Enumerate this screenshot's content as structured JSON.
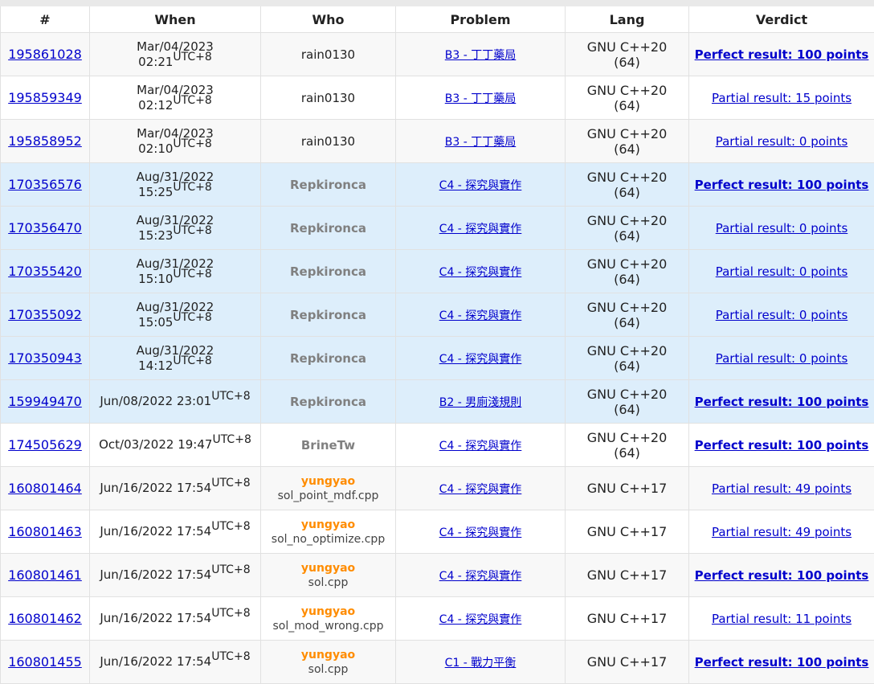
{
  "columns": {
    "id": "#",
    "when": "When",
    "who": "Who",
    "problem": "Problem",
    "lang": "Lang",
    "verdict": "Verdict"
  },
  "colors": {
    "perfect": "#00a900",
    "partial": "#0000cc",
    "gray_handle": "#808080",
    "orange_handle": "#ff8c00",
    "row_highlight": "#ddeefb"
  },
  "rows": [
    {
      "id": "195861028",
      "date": "Mar/04/2023",
      "time": "02:21",
      "tz": "UTC+8",
      "who": "rain0130",
      "file": "",
      "problem": "B3 - 丁丁藥局",
      "lang1": "GNU C++20",
      "lang2": "(64)",
      "verdict": "Perfect result: 100 points",
      "bg": "gray",
      "whoStyle": "plain",
      "vStyle": "perfect"
    },
    {
      "id": "195859349",
      "date": "Mar/04/2023",
      "time": "02:12",
      "tz": "UTC+8",
      "who": "rain0130",
      "file": "",
      "problem": "B3 - 丁丁藥局",
      "lang1": "GNU C++20",
      "lang2": "(64)",
      "verdict": "Partial result: 15 points",
      "bg": "white",
      "whoStyle": "plain",
      "vStyle": "partial"
    },
    {
      "id": "195858952",
      "date": "Mar/04/2023",
      "time": "02:10",
      "tz": "UTC+8",
      "who": "rain0130",
      "file": "",
      "problem": "B3 - 丁丁藥局",
      "lang1": "GNU C++20",
      "lang2": "(64)",
      "verdict": "Partial result: 0 points",
      "bg": "gray",
      "whoStyle": "plain",
      "vStyle": "partial"
    },
    {
      "id": "170356576",
      "date": "Aug/31/2022",
      "time": "15:25",
      "tz": "UTC+8",
      "who": "Repkironca",
      "file": "",
      "problem": "C4 - 探究與實作",
      "lang1": "GNU C++20",
      "lang2": "(64)",
      "verdict": "Perfect result: 100 points",
      "bg": "blue",
      "whoStyle": "gray",
      "vStyle": "perfect"
    },
    {
      "id": "170356470",
      "date": "Aug/31/2022",
      "time": "15:23",
      "tz": "UTC+8",
      "who": "Repkironca",
      "file": "",
      "problem": "C4 - 探究與實作",
      "lang1": "GNU C++20",
      "lang2": "(64)",
      "verdict": "Partial result: 0 points",
      "bg": "blue",
      "whoStyle": "gray",
      "vStyle": "partial"
    },
    {
      "id": "170355420",
      "date": "Aug/31/2022",
      "time": "15:10",
      "tz": "UTC+8",
      "who": "Repkironca",
      "file": "",
      "problem": "C4 - 探究與實作",
      "lang1": "GNU C++20",
      "lang2": "(64)",
      "verdict": "Partial result: 0 points",
      "bg": "blue",
      "whoStyle": "gray",
      "vStyle": "partial"
    },
    {
      "id": "170355092",
      "date": "Aug/31/2022",
      "time": "15:05",
      "tz": "UTC+8",
      "who": "Repkironca",
      "file": "",
      "problem": "C4 - 探究與實作",
      "lang1": "GNU C++20",
      "lang2": "(64)",
      "verdict": "Partial result: 0 points",
      "bg": "blue",
      "whoStyle": "gray",
      "vStyle": "partial"
    },
    {
      "id": "170350943",
      "date": "Aug/31/2022",
      "time": "14:12",
      "tz": "UTC+8",
      "who": "Repkironca",
      "file": "",
      "problem": "C4 - 探究與實作",
      "lang1": "GNU C++20",
      "lang2": "(64)",
      "verdict": "Partial result: 0 points",
      "bg": "blue",
      "whoStyle": "gray",
      "vStyle": "partial"
    },
    {
      "id": "159949470",
      "date": "Jun/08/2022",
      "time": "23:01",
      "tz": "UTC+8",
      "who": "Repkironca",
      "file": "",
      "problem": "B2 - 男廁淺規則",
      "lang1": "GNU C++20",
      "lang2": "(64)",
      "verdict": "Perfect result: 100 points",
      "bg": "blue",
      "whoStyle": "gray",
      "vStyle": "perfect",
      "oneLine": true
    },
    {
      "id": "174505629",
      "date": "Oct/03/2022",
      "time": "19:47",
      "tz": "UTC+8",
      "who": "BrineTw",
      "file": "",
      "problem": "C4 - 探究與實作",
      "lang1": "GNU C++20",
      "lang2": "(64)",
      "verdict": "Perfect result: 100 points",
      "bg": "white",
      "whoStyle": "gray",
      "vStyle": "perfect",
      "oneLine": true
    },
    {
      "id": "160801464",
      "date": "Jun/16/2022",
      "time": "17:54",
      "tz": "UTC+8",
      "who": "yungyao",
      "file": "sol_point_mdf.cpp",
      "problem": "C4 - 探究與實作",
      "lang1": "GNU C++17",
      "lang2": "",
      "verdict": "Partial result: 49 points",
      "bg": "gray",
      "whoStyle": "orange",
      "vStyle": "partial",
      "oneLine": true
    },
    {
      "id": "160801463",
      "date": "Jun/16/2022",
      "time": "17:54",
      "tz": "UTC+8",
      "who": "yungyao",
      "file": "sol_no_optimize.cpp",
      "problem": "C4 - 探究與實作",
      "lang1": "GNU C++17",
      "lang2": "",
      "verdict": "Partial result: 49 points",
      "bg": "white",
      "whoStyle": "orange",
      "vStyle": "partial",
      "oneLine": true
    },
    {
      "id": "160801461",
      "date": "Jun/16/2022",
      "time": "17:54",
      "tz": "UTC+8",
      "who": "yungyao",
      "file": "sol.cpp",
      "problem": "C4 - 探究與實作",
      "lang1": "GNU C++17",
      "lang2": "",
      "verdict": "Perfect result: 100 points",
      "bg": "gray",
      "whoStyle": "orange",
      "vStyle": "perfect",
      "oneLine": true
    },
    {
      "id": "160801462",
      "date": "Jun/16/2022",
      "time": "17:54",
      "tz": "UTC+8",
      "who": "yungyao",
      "file": "sol_mod_wrong.cpp",
      "problem": "C4 - 探究與實作",
      "lang1": "GNU C++17",
      "lang2": "",
      "verdict": "Partial result: 11 points",
      "bg": "white",
      "whoStyle": "orange",
      "vStyle": "partial",
      "oneLine": true
    },
    {
      "id": "160801455",
      "date": "Jun/16/2022",
      "time": "17:54",
      "tz": "UTC+8",
      "who": "yungyao",
      "file": "sol.cpp",
      "problem": "C1 - 戰力平衡",
      "lang1": "GNU C++17",
      "lang2": "",
      "verdict": "Perfect result: 100 points",
      "bg": "gray",
      "whoStyle": "orange",
      "vStyle": "perfect",
      "oneLine": true
    }
  ]
}
